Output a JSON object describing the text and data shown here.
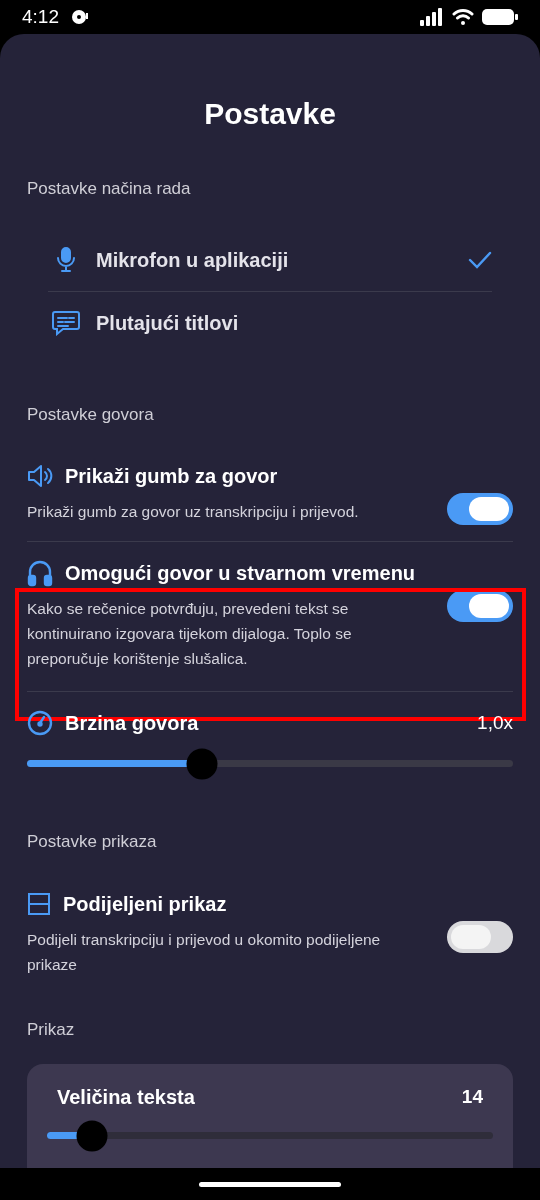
{
  "status_bar": {
    "time": "4:12"
  },
  "sheet": {
    "title": "Postavke"
  },
  "mode_section": {
    "label": "Postavke načina rada",
    "options": [
      {
        "kind": "mic",
        "label": "Mikrofon u aplikaciji",
        "selected": true
      },
      {
        "kind": "subtitles",
        "label": "Plutajući titlovi",
        "selected": false
      }
    ]
  },
  "speech_section": {
    "label": "Postavke govora",
    "items": [
      {
        "kind": "toggle",
        "title": "Prikaži gumb za govor",
        "description": "Prikaži gumb za govor uz transkripciju i prijevod.",
        "on": true
      },
      {
        "kind": "toggle",
        "title": "Omogući govor u stvarnom vremenu",
        "description": "Kako se rečenice potvrđuju, prevedeni tekst se kontinuirano izgovara tijekom dijaloga. Toplo se preporučuje korištenje slušalica.",
        "on": true
      },
      {
        "kind": "slider",
        "title": "Brzina govora",
        "value": "1,0x",
        "level": 0.36
      }
    ]
  },
  "display_section": {
    "label": "Postavke prikaza",
    "items": [
      {
        "kind": "toggle",
        "title": "Podijeljeni prikaz",
        "description": "Podijeli transkripciju i prijevod u okomito podijeljene prikaze",
        "on": false
      }
    ]
  },
  "view_section": {
    "label": "Prikaz",
    "card": {
      "title": "Veličina teksta",
      "value": "14",
      "level": 0.1
    }
  },
  "annotation": {
    "kind": "highlight_box"
  }
}
